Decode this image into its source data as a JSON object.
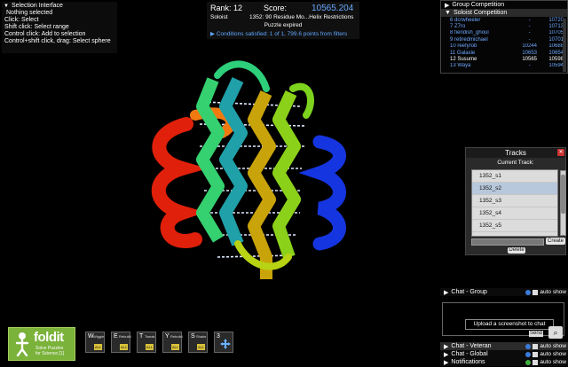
{
  "selection": {
    "title": "Selection Interface",
    "lines": [
      "Nothing selected",
      "Click: Select",
      "Shift click: Select range",
      "Control click: Add to selection",
      "Control+shift click, drag: Select sphere"
    ]
  },
  "score": {
    "rank_label": "Rank: 12",
    "score_label": "Score:",
    "score_value": "10565.204",
    "mode": "Soloist",
    "puzzle": "1352: 90 Residue Mo...Helix Restrictions",
    "status": "Puzzle expired",
    "conditions": "Conditions satisfied: 1 of 1, 799.6 points from filters"
  },
  "competition": {
    "group_label": "Group Competition",
    "soloist_label": "Soloist Competition",
    "rows": [
      {
        "name": "6 dcrwheeler",
        "dash": "-",
        "score": "10720"
      },
      {
        "name": "7 Z7ro",
        "dash": "-",
        "score": "10713"
      },
      {
        "name": "8 fiendish_ghoul",
        "dash": "-",
        "score": "10705"
      },
      {
        "name": "9 retiredmichael",
        "dash": "-",
        "score": "10701"
      },
      {
        "name": "10 reefyrob",
        "dash": "10244",
        "score": "10688"
      },
      {
        "name": "11 Galaxie",
        "dash": "10653",
        "score": "10654"
      },
      {
        "name": "12 Susume",
        "dash": "10565",
        "score": "10598"
      },
      {
        "name": "13 Waya",
        "dash": "-",
        "score": "10594"
      }
    ]
  },
  "tracks": {
    "title": "Tracks",
    "current_label": "Current Track:",
    "items": [
      "1352_s1",
      "1352_s2",
      "1352_s3",
      "1352_s4",
      "1352_s5"
    ],
    "selected_index": 1,
    "create_label": "Create",
    "delete_label": "Delete"
  },
  "chat": {
    "group_label": "Chat - Group",
    "veteran_label": "Chat - Veteran",
    "global_label": "Chat - Global",
    "notifications_label": "Notifications",
    "auto_show": "auto show",
    "tooltip": "Upload a screenshot to chat",
    "send_label": "Send"
  },
  "logo": {
    "name": "foldit",
    "tagline_1": "Solve Puzzles",
    "tagline_2": "for Science",
    "version_badge": "[1]"
  },
  "toolbar": {
    "tools": [
      {
        "letter": "W",
        "sub": "Wiggle",
        "kbd": "ALL"
      },
      {
        "letter": "E",
        "sub": "Rebuild",
        "kbd": "ALL"
      },
      {
        "letter": "T",
        "sub": "Tweak",
        "kbd": "ALL"
      },
      {
        "letter": "Y",
        "sub": "Rebuild",
        "kbd": "ALL"
      },
      {
        "letter": "S",
        "sub": "Shake",
        "kbd": "ALL"
      },
      {
        "letter": "3",
        "sub": "",
        "kbd": ""
      }
    ]
  },
  "colors": {
    "accent_blue": "#5fa7ff",
    "panel_bg": "#2a2a2a",
    "logo_green": "#7ab23a"
  }
}
